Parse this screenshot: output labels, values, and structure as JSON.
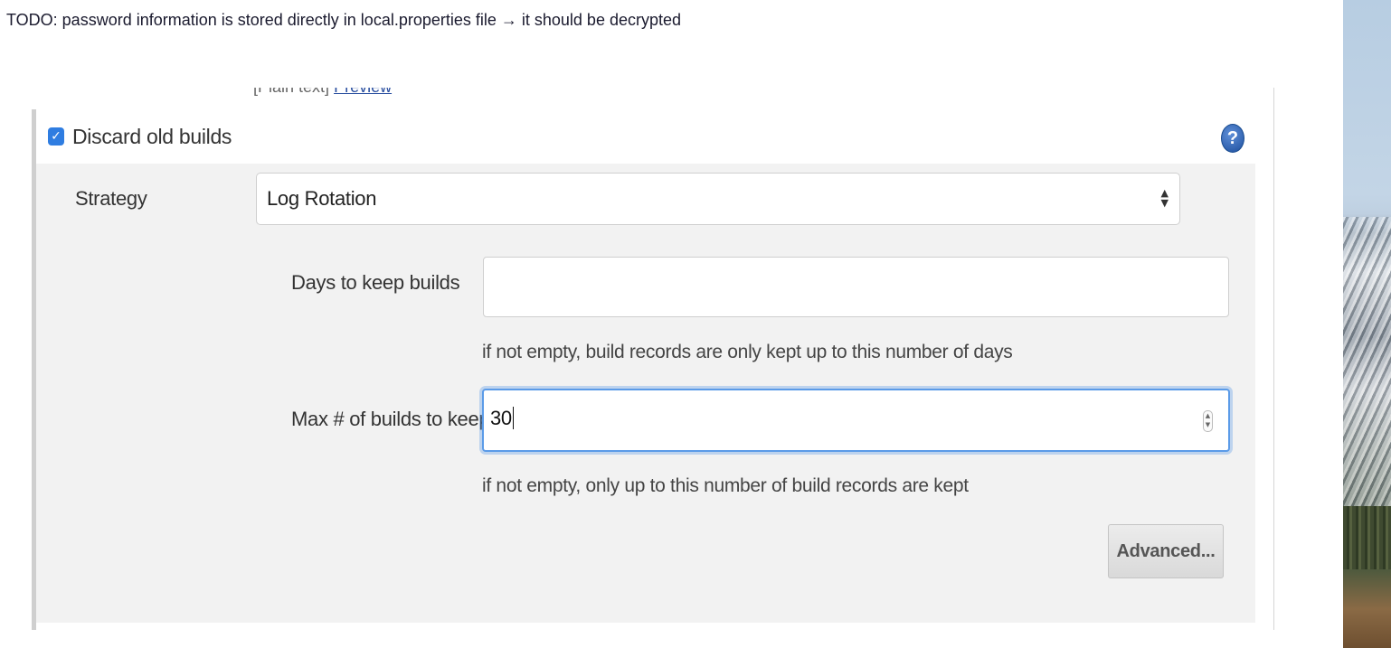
{
  "note": {
    "text": "TODO: password information is stored directly in local.properties file → it should be decrypted"
  },
  "panel": {
    "cut_off_prefix": "[Plain text]",
    "cut_off_link": "Preview",
    "discard": {
      "checked": true,
      "checkmark": "✓",
      "label": "Discard old builds"
    },
    "help_icon": {
      "glyph": "?"
    },
    "strategy": {
      "label": "Strategy",
      "selected": "Log Rotation"
    },
    "days_to_keep": {
      "label": "Days to keep builds",
      "value": "",
      "hint": "if not empty, build records are only kept up to this number of days"
    },
    "max_builds": {
      "label": "Max # of builds to keep",
      "value": "30",
      "hint": "if not empty, only up to this number of build records are kept"
    },
    "advanced_button": {
      "label": "Advanced..."
    }
  },
  "colors": {
    "checkbox": "#2f7de1",
    "focus_ring": "#5b9be8",
    "section_bg": "#f2f2f2"
  }
}
